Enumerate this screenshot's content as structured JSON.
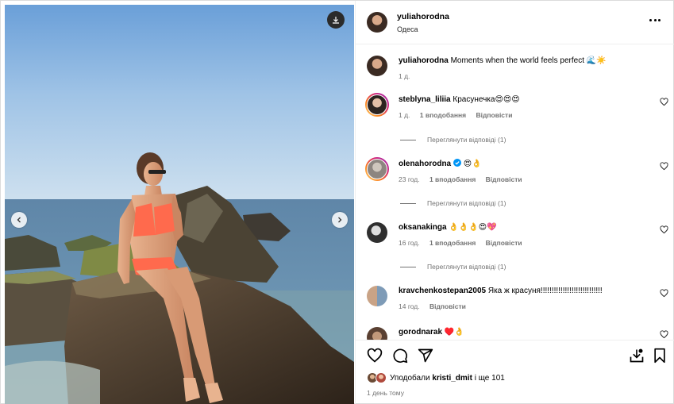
{
  "post": {
    "username": "yuliahorodna",
    "location": "Одеса",
    "caption_user": "yuliahorodna",
    "caption_text": "Moments when the world feels perfect 🌊☀️",
    "caption_time": "1 д."
  },
  "icons": {
    "more": "more-options-icon",
    "download": "download-icon",
    "prev": "chevron-left-icon",
    "next": "chevron-right-icon",
    "like": "heart-icon",
    "comment": "comment-icon",
    "share": "share-icon",
    "save": "bookmark-icon"
  },
  "comments": [
    {
      "user": "steblyna_liliia",
      "text": "Красунечка😍😍😍",
      "time": "1 д.",
      "likes": "1 вподобання",
      "reply": "Відповісти",
      "view_replies": "Переглянути відповіді (1)"
    },
    {
      "user": "olenahorodna",
      "text": "😍👌",
      "time": "23 год.",
      "likes": "1 вподобання",
      "reply": "Відповісти",
      "view_replies": "Переглянути відповіді (1)"
    },
    {
      "user": "oksanakinga",
      "text": "👌👌👌😍💖",
      "time": "16 год.",
      "likes": "1 вподобання",
      "reply": "Відповісти",
      "view_replies": "Переглянути відповіді (1)"
    },
    {
      "user": "kravchenkostepan2005",
      "text": "Яка ж красуня!!!!!!!!!!!!!!!!!!!!!!!!!!!!",
      "time": "14 год.",
      "reply": "Відповісти"
    },
    {
      "user": "gorodnarak",
      "text": "♥️👌"
    }
  ],
  "footer": {
    "liked_prefix": "Уподобали",
    "liked_user": "kristi_dmit",
    "liked_suffix": "і ще 101",
    "date": "1 день тому"
  },
  "colors": {
    "verified": "#0095f6",
    "muted": "#737373"
  }
}
